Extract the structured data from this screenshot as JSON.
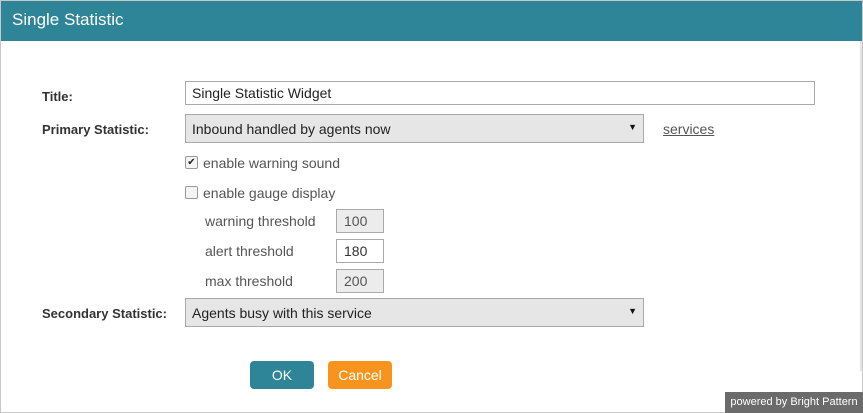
{
  "dialog": {
    "title": "Single Statistic"
  },
  "form": {
    "title_label": "Title:",
    "title_value": "Single Statistic Widget",
    "primary_label": "Primary Statistic:",
    "primary_value": "Inbound handled by agents now",
    "services_link": "services",
    "warning_sound": {
      "label": "enable warning sound",
      "checked": true
    },
    "gauge_display": {
      "label": "enable gauge display",
      "checked": false
    },
    "warning_threshold": {
      "label": "warning threshold",
      "value": "100"
    },
    "alert_threshold": {
      "label": "alert threshold",
      "value": "180"
    },
    "max_threshold": {
      "label": "max threshold",
      "value": "200"
    },
    "secondary_label": "Secondary Statistic:",
    "secondary_value": "Agents busy with this service"
  },
  "buttons": {
    "ok": "OK",
    "cancel": "Cancel"
  },
  "footer": {
    "powered": "powered by Bright Pattern"
  },
  "icons": {
    "checkmark": "✔",
    "dropdown": "▼"
  },
  "colors": {
    "header": "#2e8597",
    "ok_button": "#2e8597",
    "cancel_button": "#f7941d"
  }
}
